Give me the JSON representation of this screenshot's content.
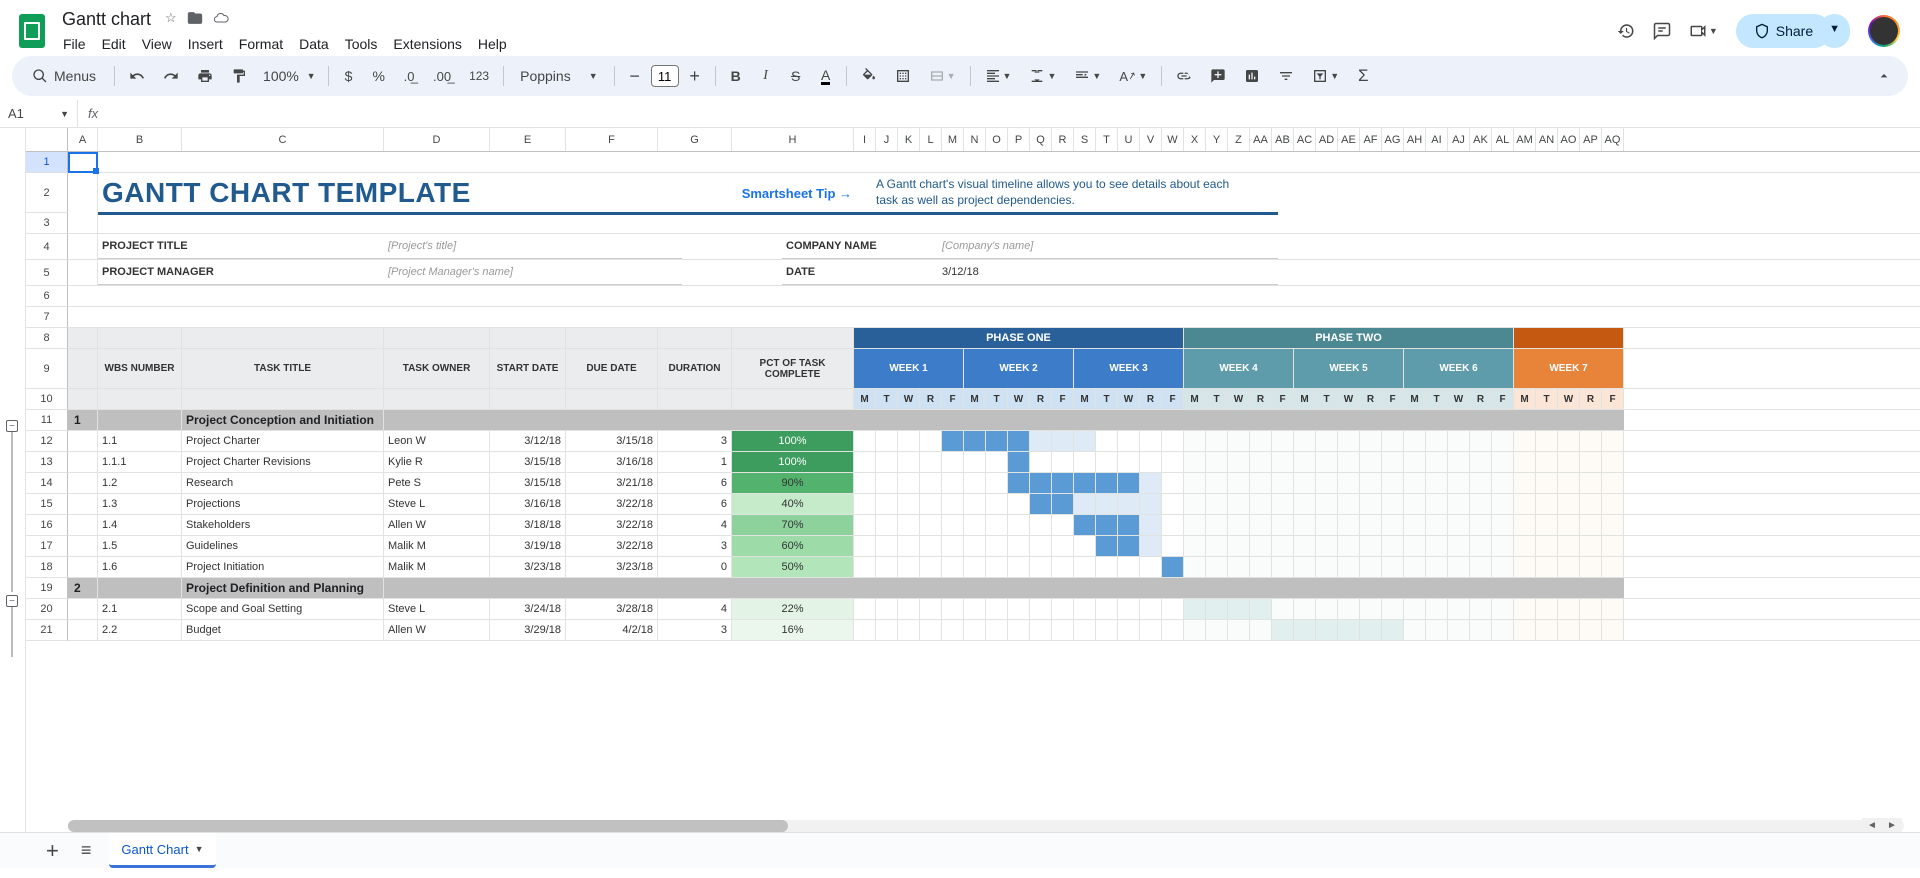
{
  "document": {
    "name": "Gantt chart",
    "cell_ref": "A1"
  },
  "menus": [
    "File",
    "Edit",
    "View",
    "Insert",
    "Format",
    "Data",
    "Tools",
    "Extensions",
    "Help"
  ],
  "toolbar": {
    "search_label": "Menus",
    "zoom": "100%",
    "font": "Poppins",
    "font_size": "11"
  },
  "share": {
    "label": "Share"
  },
  "tabs": {
    "sheet1": "Gantt Chart"
  },
  "col_letters_main": [
    "A",
    "B",
    "C",
    "D",
    "E",
    "F",
    "G",
    "H"
  ],
  "col_letters_small": [
    "I",
    "J",
    "K",
    "L",
    "M",
    "N",
    "O",
    "P",
    "Q",
    "R",
    "S",
    "T",
    "U",
    "V",
    "W",
    "X",
    "Y",
    "Z",
    "AA",
    "AB",
    "AC",
    "AD",
    "AE",
    "AF",
    "AG",
    "AH",
    "AI",
    "AJ",
    "AK",
    "AL",
    "AM",
    "AN",
    "AO",
    "AP",
    "AQ"
  ],
  "row_numbers_used": 21,
  "content": {
    "title": "GANTT CHART TEMPLATE",
    "tip_label": "Smartsheet Tip →",
    "tip_text": "A Gantt chart's visual timeline allows you to see details about each task as well as project dependencies.",
    "meta": {
      "project_title_label": "PROJECT TITLE",
      "project_title_value": "[Project's title]",
      "company_label": "COMPANY NAME",
      "company_value": "[Company's name]",
      "pm_label": "PROJECT MANAGER",
      "pm_value": "[Project Manager's name]",
      "date_label": "DATE",
      "date_value": "3/12/18"
    },
    "headers": {
      "wbs": "WBS NUMBER",
      "task": "TASK TITLE",
      "owner": "TASK OWNER",
      "start": "START DATE",
      "due": "DUE DATE",
      "duration": "DURATION",
      "pct": "PCT OF TASK COMPLETE",
      "phase1": "PHASE ONE",
      "phase2": "PHASE TWO",
      "week1": "WEEK 1",
      "week2": "WEEK 2",
      "week3": "WEEK 3",
      "week4": "WEEK 4",
      "week5": "WEEK 5",
      "week6": "WEEK 6",
      "week7": "WEEK 7"
    },
    "days": [
      "M",
      "T",
      "W",
      "R",
      "F"
    ],
    "section1": {
      "num": "1",
      "title": "Project Conception and Initiation"
    },
    "section2": {
      "num": "2",
      "title": "Project Definition and Planning"
    },
    "rows": [
      {
        "wbs": "1.1",
        "task": "Project Charter",
        "owner": "Leon W",
        "start": "3/12/18",
        "due": "3/15/18",
        "dur": "3",
        "pct": "100%",
        "pctcls": "pct-100",
        "fills": [
          4,
          5,
          6,
          7
        ],
        "lights": [
          8,
          9,
          10
        ]
      },
      {
        "wbs": "1.1.1",
        "task": "Project Charter Revisions",
        "owner": "Kylie R",
        "start": "3/15/18",
        "due": "3/16/18",
        "dur": "1",
        "pct": "100%",
        "pctcls": "pct-100",
        "fills": [
          7
        ],
        "lights": []
      },
      {
        "wbs": "1.2",
        "task": "Research",
        "owner": "Pete S",
        "start": "3/15/18",
        "due": "3/21/18",
        "dur": "6",
        "pct": "90%",
        "pctcls": "pct-90",
        "fills": [
          7,
          8,
          9,
          10,
          11,
          12
        ],
        "lights": [
          13
        ]
      },
      {
        "wbs": "1.3",
        "task": "Projections",
        "owner": "Steve L",
        "start": "3/16/18",
        "due": "3/22/18",
        "dur": "6",
        "pct": "40%",
        "pctcls": "pct-40",
        "fills": [
          8,
          9
        ],
        "lights": [
          10,
          11,
          12,
          13
        ]
      },
      {
        "wbs": "1.4",
        "task": "Stakeholders",
        "owner": "Allen W",
        "start": "3/18/18",
        "due": "3/22/18",
        "dur": "4",
        "pct": "70%",
        "pctcls": "pct-70",
        "fills": [
          10,
          11,
          12
        ],
        "lights": [
          13
        ]
      },
      {
        "wbs": "1.5",
        "task": "Guidelines",
        "owner": "Malik M",
        "start": "3/19/18",
        "due": "3/22/18",
        "dur": "3",
        "pct": "60%",
        "pctcls": "pct-60",
        "fills": [
          11,
          12
        ],
        "lights": [
          13
        ]
      },
      {
        "wbs": "1.6",
        "task": "Project Initiation",
        "owner": "Malik M",
        "start": "3/23/18",
        "due": "3/23/18",
        "dur": "0",
        "pct": "50%",
        "pctcls": "pct-50",
        "fills": [
          14
        ],
        "lights": []
      }
    ],
    "rows2": [
      {
        "wbs": "2.1",
        "task": "Scope and Goal Setting",
        "owner": "Steve L",
        "start": "3/24/18",
        "due": "3/28/18",
        "dur": "4",
        "pct": "22%",
        "pctcls": "pct-22",
        "light2": [
          15
        ],
        "lights": [
          16,
          17,
          18
        ]
      },
      {
        "wbs": "2.2",
        "task": "Budget",
        "owner": "Allen W",
        "start": "3/29/18",
        "due": "4/2/18",
        "dur": "3",
        "pct": "16%",
        "pctcls": "pct-16",
        "light2": [
          19
        ],
        "lights": [
          20,
          21,
          22,
          23,
          24
        ]
      }
    ]
  }
}
